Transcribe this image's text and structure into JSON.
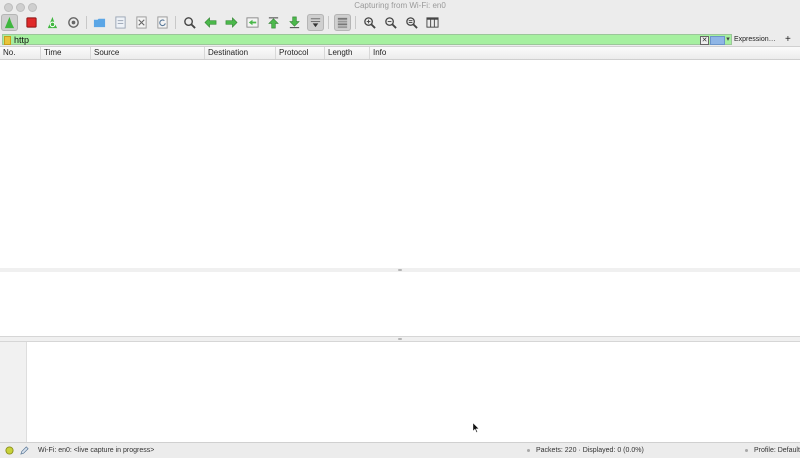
{
  "window": {
    "title": "Capturing from Wi-Fi: en0"
  },
  "toolbar": {
    "buttons": [
      {
        "icon": "shark-fin-start-icon",
        "color": "#3fb63f"
      },
      {
        "icon": "stop-capture-icon",
        "color": "#e02a2a"
      },
      {
        "icon": "restart-capture-icon",
        "color": "#3fb63f"
      },
      {
        "icon": "capture-options-icon",
        "color": "#666666"
      },
      {
        "icon": "open-file-icon",
        "color": "#5ba6e6"
      },
      {
        "icon": "save-file-icon",
        "color": "#9aa5b4"
      },
      {
        "icon": "close-file-icon",
        "color": "#666666"
      },
      {
        "icon": "reload-file-icon",
        "color": "#5a7a9a"
      },
      {
        "icon": "find-packet-icon",
        "color": "#444444"
      },
      {
        "icon": "go-back-icon",
        "color": "#4bb84b"
      },
      {
        "icon": "go-forward-icon",
        "color": "#4bb84b"
      },
      {
        "icon": "go-to-packet-icon",
        "color": "#4bb84b"
      },
      {
        "icon": "first-packet-icon",
        "color": "#4bb84b"
      },
      {
        "icon": "last-packet-icon",
        "color": "#4bb84b"
      },
      {
        "icon": "auto-scroll-icon",
        "color": "#333333"
      },
      {
        "icon": "colorize-icon",
        "color": "#666666"
      },
      {
        "icon": "zoom-in-icon",
        "color": "#444444"
      },
      {
        "icon": "zoom-out-icon",
        "color": "#444444"
      },
      {
        "icon": "normal-size-icon",
        "color": "#444444"
      },
      {
        "icon": "resize-columns-icon",
        "color": "#444444"
      }
    ]
  },
  "filter": {
    "value": "http",
    "expression_label": "Expression…",
    "add_label": "+",
    "clear_glyph": "✕",
    "dropdown_glyph": "▾",
    "background_color": "#a6f0a0"
  },
  "packet_list": {
    "columns": [
      "No.",
      "Time",
      "Source",
      "Destination",
      "Protocol",
      "Length",
      "Info"
    ]
  },
  "status": {
    "interface": "Wi-Fi: en0: <live capture in progress>",
    "packets": "Packets: 220 · Displayed: 0 (0.0%)",
    "profile": "Profile: Default"
  }
}
